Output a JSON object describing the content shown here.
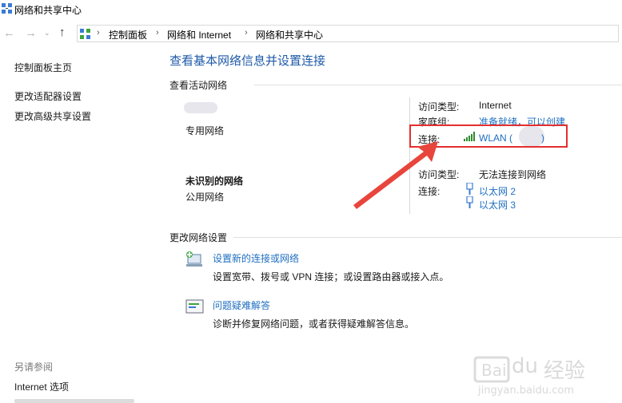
{
  "window": {
    "title": "网络和共享中心"
  },
  "breadcrumb": [
    "控制面板",
    "网络和 Internet",
    "网络和共享中心"
  ],
  "sidebar": {
    "links": [
      "控制面板主页",
      "更改适配器设置",
      "更改高级共享设置"
    ],
    "see_also_title": "另请参阅",
    "see_also": [
      "Internet 选项"
    ]
  },
  "main": {
    "heading": "查看基本网络信息并设置连接",
    "active_networks_title": "查看活动网络",
    "network1": {
      "type": "专用网络",
      "access_type_label": "访问类型:",
      "access_type_value": "Internet",
      "homegroup_label": "家庭组:",
      "homegroup_value": "准备就绪，可以创建",
      "connection_label": "连接:",
      "connection_value": "WLAN (",
      "connection_suffix": ")"
    },
    "network2": {
      "name": "未识别的网络",
      "type": "公用网络",
      "access_type_label": "访问类型:",
      "access_type_value": "无法连接到网络",
      "connection_label": "连接:",
      "connections": [
        "以太网 2",
        "以太网 3"
      ]
    },
    "change_settings_title": "更改网络设置",
    "tasks": [
      {
        "title": "设置新的连接或网络",
        "desc": "设置宽带、拨号或 VPN 连接；或设置路由器或接入点。",
        "icon": "network-setup-icon"
      },
      {
        "title": "问题疑难解答",
        "desc": "诊断并修复网络问题，或者获得疑难解答信息。",
        "icon": "troubleshoot-icon"
      }
    ]
  },
  "watermark": {
    "brand": "Bai",
    "brand2": "经验",
    "url": "jingyan.baidu.com"
  },
  "colors": {
    "link": "#1f6fc0",
    "heading": "#1e5aa8",
    "highlight": "#e52e2e",
    "arrow": "#e8453c"
  }
}
